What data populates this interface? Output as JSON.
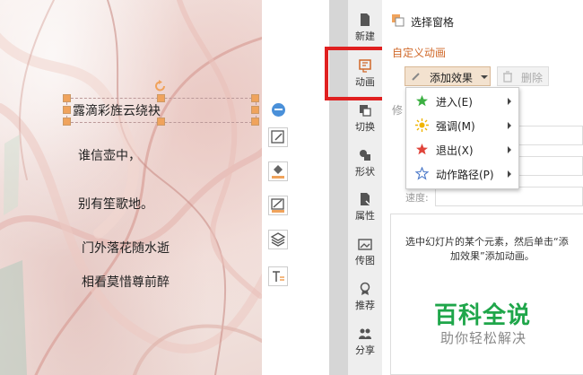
{
  "slide": {
    "title_line": "露滴彩旌云绕袂",
    "lines": [
      "谁信壶中，",
      "别有笙歌地。",
      "门外落花随水逝",
      "相看莫惜尊前醉"
    ]
  },
  "nav": {
    "items": [
      {
        "label": "新建",
        "icon": "new-icon"
      },
      {
        "label": "动画",
        "icon": "animation-icon"
      },
      {
        "label": "切换",
        "icon": "transition-icon"
      },
      {
        "label": "形状",
        "icon": "shape-icon"
      },
      {
        "label": "属性",
        "icon": "properties-icon"
      },
      {
        "label": "传图",
        "icon": "upload-image-icon"
      },
      {
        "label": "推荐",
        "icon": "recommend-icon"
      },
      {
        "label": "分享",
        "icon": "share-icon"
      }
    ]
  },
  "panel": {
    "selection_pane": "选择窗格",
    "custom_animation": "自定义动画",
    "add_effect": "添加效果",
    "delete": "删除",
    "modify_partial": "修",
    "speed_label": "速度:",
    "menu": [
      {
        "label": "进入(E)",
        "icon": "enter-star-icon",
        "color": "#3cb043"
      },
      {
        "label": "强调(M)",
        "icon": "emphasis-burst-icon",
        "color": "#f0b400"
      },
      {
        "label": "退出(X)",
        "icon": "exit-star-icon",
        "color": "#e0443a"
      },
      {
        "label": "动作路径(P)",
        "icon": "motion-path-star-icon",
        "color": "#4a78c8"
      }
    ],
    "info_line1": "选中幻灯片的某个元素，然后单击“添",
    "info_line2": "加效果”添加动画。"
  },
  "watermark": {
    "title": "百科全说",
    "subtitle": "助你轻松解决"
  },
  "colors": {
    "highlight": "#e02020",
    "panel_title": "#d0692a",
    "watermark_green": "#1fa64a"
  }
}
